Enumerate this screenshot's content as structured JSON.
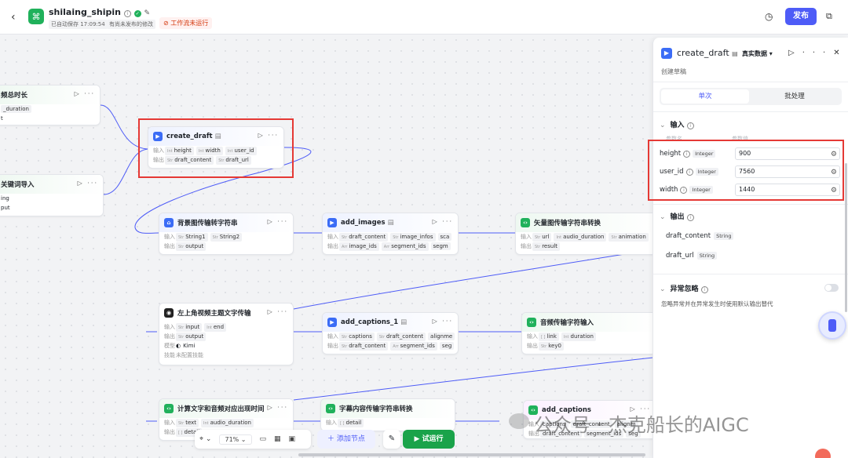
{
  "header": {
    "back": "‹",
    "app_name": "shilaing_shipin",
    "saved": "已自动保存 17:09:54",
    "unpublished": "有尚未发布的修改",
    "workflow_status": "工作流未运行",
    "publish": "发布"
  },
  "nodes": {
    "n1": {
      "title": "频总时长",
      "out": "_duration",
      "out2": "t"
    },
    "n2": {
      "title": "关键词导入",
      "r1": "ing",
      "r2": "put"
    },
    "create": {
      "title": "create_draft",
      "in_label": "输入",
      "out_label": "输出",
      "inputs": [
        "height",
        "width",
        "user_id"
      ],
      "outputs": [
        "draft_content",
        "draft_url"
      ]
    },
    "bg": {
      "title": "背景图传输转字符串",
      "in_label": "输入",
      "out_label": "输出",
      "inputs": [
        "String1",
        "String2"
      ],
      "outputs": [
        "output"
      ]
    },
    "images": {
      "title": "add_images",
      "in_label": "输入",
      "out_label": "输出",
      "inputs": [
        "draft_content",
        "image_infos",
        "sca"
      ],
      "outputs": [
        "image_ids",
        "segment_ids",
        "segm"
      ]
    },
    "vec": {
      "title": "矢量图传输字符串转换",
      "in_label": "输入",
      "out_label": "输出",
      "inputs": [
        "url",
        "audio_duration",
        "animation"
      ],
      "outputs": [
        "result"
      ]
    },
    "topleft": {
      "title": "左上角视频主题文字传输",
      "in_label": "输入",
      "out_label": "输出",
      "inputs": [
        "input",
        "end"
      ],
      "outputs": [
        "output"
      ],
      "model_label": "模型",
      "model": "Kimi",
      "skill_label": "技能",
      "skill": "未配置技能"
    },
    "captions1": {
      "title": "add_captions_1",
      "in_label": "输入",
      "out_label": "输出",
      "inputs": [
        "captions",
        "draft_content",
        "alignme"
      ],
      "outputs": [
        "draft_content",
        "segment_ids",
        "seg"
      ]
    },
    "audio": {
      "title": "音频传输字符输入",
      "in_label": "输入",
      "out_label": "输出",
      "inputs": [
        "link",
        "duration"
      ],
      "outputs": [
        "key0"
      ]
    },
    "calc": {
      "title": "计算文字和音频对应出现时间",
      "in_label": "输入",
      "out_label": "输出",
      "inputs": [
        "text",
        "audio_duration"
      ],
      "outputs": [
        "detail"
      ]
    },
    "subtitle": {
      "title": "字幕内容传输字符串转换",
      "in_label": "输入",
      "out_label": "输出",
      "inputs": [
        "detail"
      ]
    },
    "captions": {
      "title": "add_captions",
      "in_label": "输入",
      "out_label": "输出",
      "inputs": [
        "captions",
        "draft_content",
        "alignm"
      ],
      "outputs": [
        "draft_content",
        "segment_ids",
        "seg"
      ]
    }
  },
  "toolbar": {
    "zoom": "71%",
    "add_node": "添加节点",
    "run": "试运行"
  },
  "panel": {
    "title": "create_draft",
    "mode": "真实数据",
    "desc": "创建草稿",
    "tab_single": "单次",
    "tab_batch": "批处理",
    "input_section": "输入",
    "col_name": "参数名",
    "col_value": "参数值",
    "params": [
      {
        "name": "height",
        "type": "Integer",
        "value": "900"
      },
      {
        "name": "user_id",
        "type": "Integer",
        "value": "7560"
      },
      {
        "name": "width",
        "type": "Integer",
        "value": "1440"
      }
    ],
    "output_section": "输出",
    "outputs": [
      {
        "name": "draft_content",
        "type": "String"
      },
      {
        "name": "draft_url",
        "type": "String"
      }
    ],
    "error_section": "异常忽略",
    "error_hint": "忽略异常并在异常发生时使用默认输出替代"
  },
  "watermark": "公众号 · 杰克船长的AIGC",
  "colors": {
    "accent": "#4e5cf7",
    "run": "#1aa34a",
    "highlight": "#e53935",
    "edge": "#4e5cf7"
  }
}
